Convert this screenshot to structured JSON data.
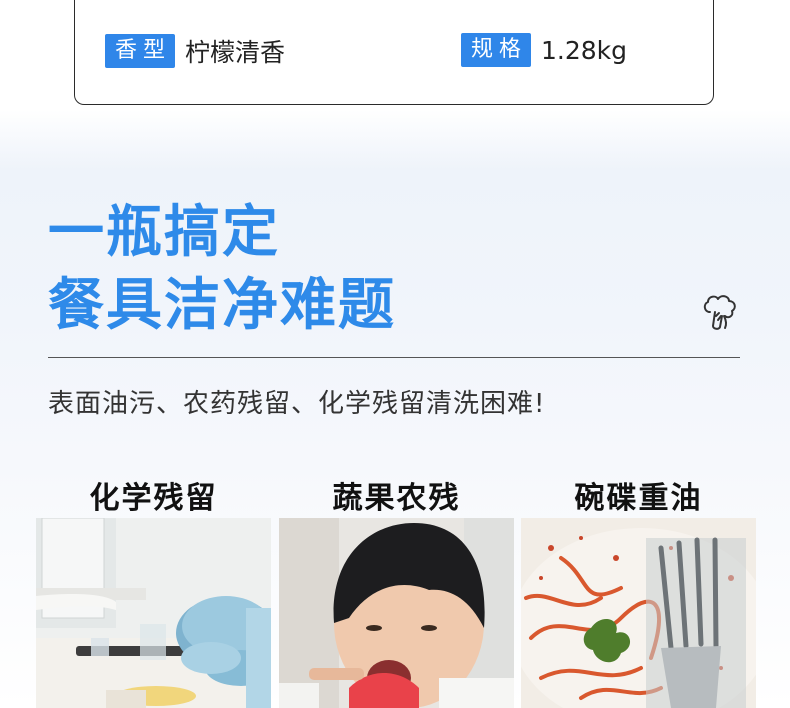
{
  "specs": [
    {
      "label": "香型",
      "value": "柠檬清香"
    },
    {
      "label": "规格",
      "value": "1.28kg"
    }
  ],
  "headline": {
    "line1": "一瓶搞定",
    "line2": "餐具洁净难题"
  },
  "subtext": "表面油污、农药残留、化学残留清洗困难!",
  "categories": [
    {
      "title": "化学残留",
      "image": "kitchen-dishes-photo"
    },
    {
      "title": "蔬果农残",
      "image": "child-eating-watermelon-photo"
    },
    {
      "title": "碗碟重油",
      "image": "greasy-pasta-plate-photo"
    }
  ],
  "icons": {
    "decor": "broccoli-icon"
  },
  "colors": {
    "accent": "#2f86e9",
    "heading": "#2e8ae9"
  }
}
